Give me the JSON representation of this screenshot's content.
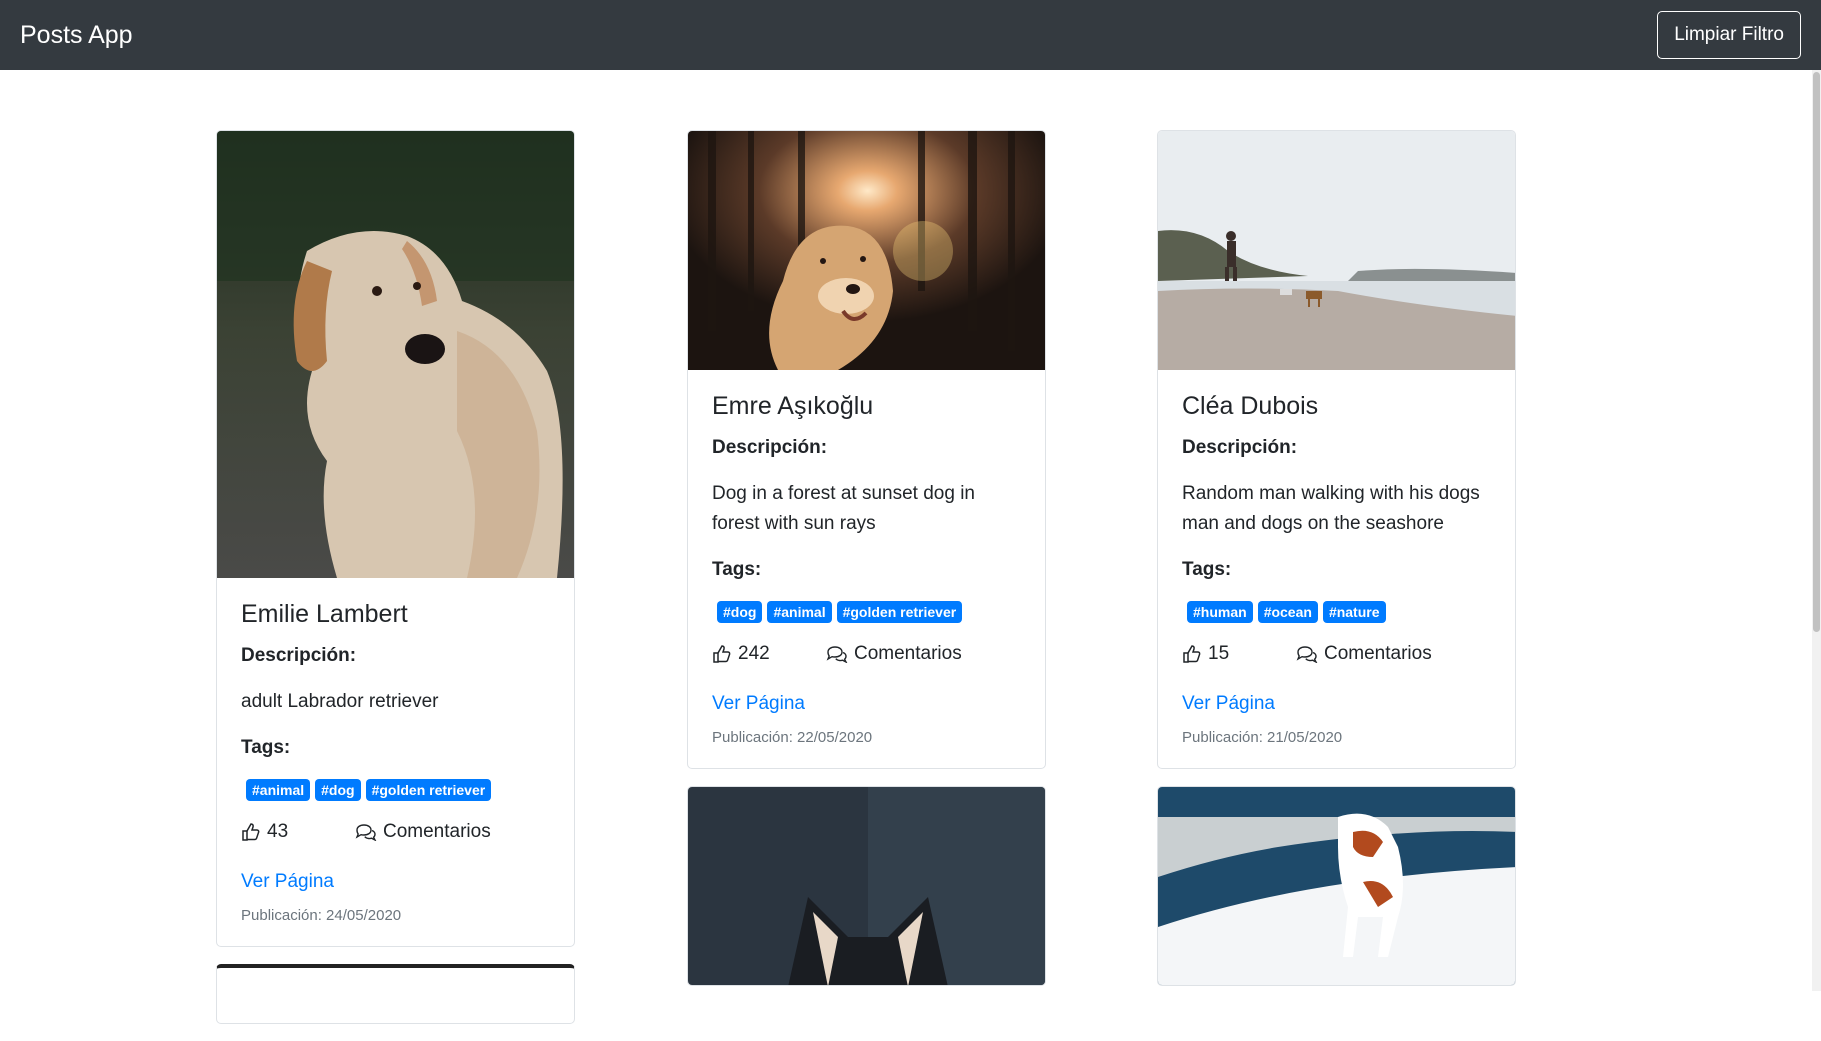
{
  "navbar": {
    "brand": "Posts App",
    "clear_filter": "Limpiar Filtro"
  },
  "labels": {
    "description": "Descripción:",
    "tags": "Tags:",
    "comments": "Comentarios",
    "view_page": "Ver Página"
  },
  "posts": [
    {
      "author": "Emilie Lambert",
      "description": "adult Labrador retriever",
      "tags": [
        "#animal",
        "#dog",
        "#golden retriever"
      ],
      "likes": "43",
      "date": "Publicación: 24/05/2020",
      "image": "golden-retriever-portrait"
    },
    {
      "author": "Emre Aşıkoğlu",
      "description": "Dog in a forest at sunset dog in forest with sun rays",
      "tags": [
        "#dog",
        "#animal",
        "#golden retriever"
      ],
      "likes": "242",
      "date": "Publicación: 22/05/2020",
      "image": "dog-forest-sunset"
    },
    {
      "author": "Cléa Dubois",
      "description": "Random man walking with his dogs man and dogs on the seashore",
      "tags": [
        "#human",
        "#ocean",
        "#nature"
      ],
      "likes": "15",
      "date": "Publicación: 21/05/2020",
      "image": "man-dogs-seashore"
    }
  ],
  "colors": {
    "navbar": "#343a40",
    "accent": "#007bff",
    "muted": "#6c757d"
  }
}
